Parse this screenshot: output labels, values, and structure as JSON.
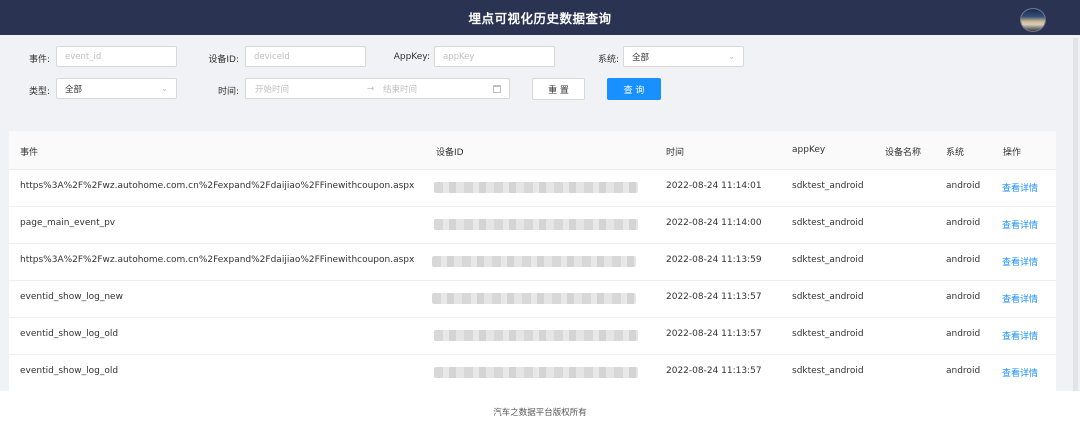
{
  "header": {
    "title": "埋点可视化历史数据查询"
  },
  "filters": {
    "event_label": "事件:",
    "event_placeholder": "event_id",
    "device_label": "设备ID:",
    "device_placeholder": "deviceId",
    "appkey_label": "AppKey:",
    "appkey_placeholder": "appKey",
    "system_label": "系统:",
    "system_value": "全部",
    "type_label": "类型:",
    "type_value": "全部",
    "time_label": "时间:",
    "start_placeholder": "开始时间",
    "arrow": "→",
    "end_placeholder": "结束时间",
    "reset_label": "重 置",
    "query_label": "查 询"
  },
  "table": {
    "columns": [
      "事件",
      "设备ID",
      "时间",
      "appKey",
      "设备名称",
      "系统",
      "操作"
    ],
    "rows": [
      {
        "event": "https%3A%2F%2Fwz.autohome.com.cn%2Fexpand%2Fdaijiao%2FFinewithcoupon.aspx",
        "time": "2022-08-24 11:14:01",
        "appkey": "sdktest_android",
        "device_name": "",
        "system": "android",
        "action": "查看详情"
      },
      {
        "event": "page_main_event_pv",
        "time": "2022-08-24 11:14:00",
        "appkey": "sdktest_android",
        "device_name": "",
        "system": "android",
        "action": "查看详情"
      },
      {
        "event": "https%3A%2F%2Fwz.autohome.com.cn%2Fexpand%2Fdaijiao%2FFinewithcoupon.aspx",
        "time": "2022-08-24 11:13:59",
        "appkey": "sdktest_android",
        "device_name": "",
        "system": "android",
        "action": "查看详情"
      },
      {
        "event": "eventid_show_log_new",
        "time": "2022-08-24 11:13:57",
        "appkey": "sdktest_android",
        "device_name": "",
        "system": "android",
        "action": "查看详情"
      },
      {
        "event": "eventid_show_log_old",
        "time": "2022-08-24 11:13:57",
        "appkey": "sdktest_android",
        "device_name": "",
        "system": "android",
        "action": "查看详情"
      },
      {
        "event": "eventid_show_log_old",
        "time": "2022-08-24 11:13:57",
        "appkey": "sdktest_android",
        "device_name": "",
        "system": "android",
        "action": "查看详情"
      }
    ]
  },
  "footer": {
    "text": "汽车之数据平台版权所有"
  }
}
